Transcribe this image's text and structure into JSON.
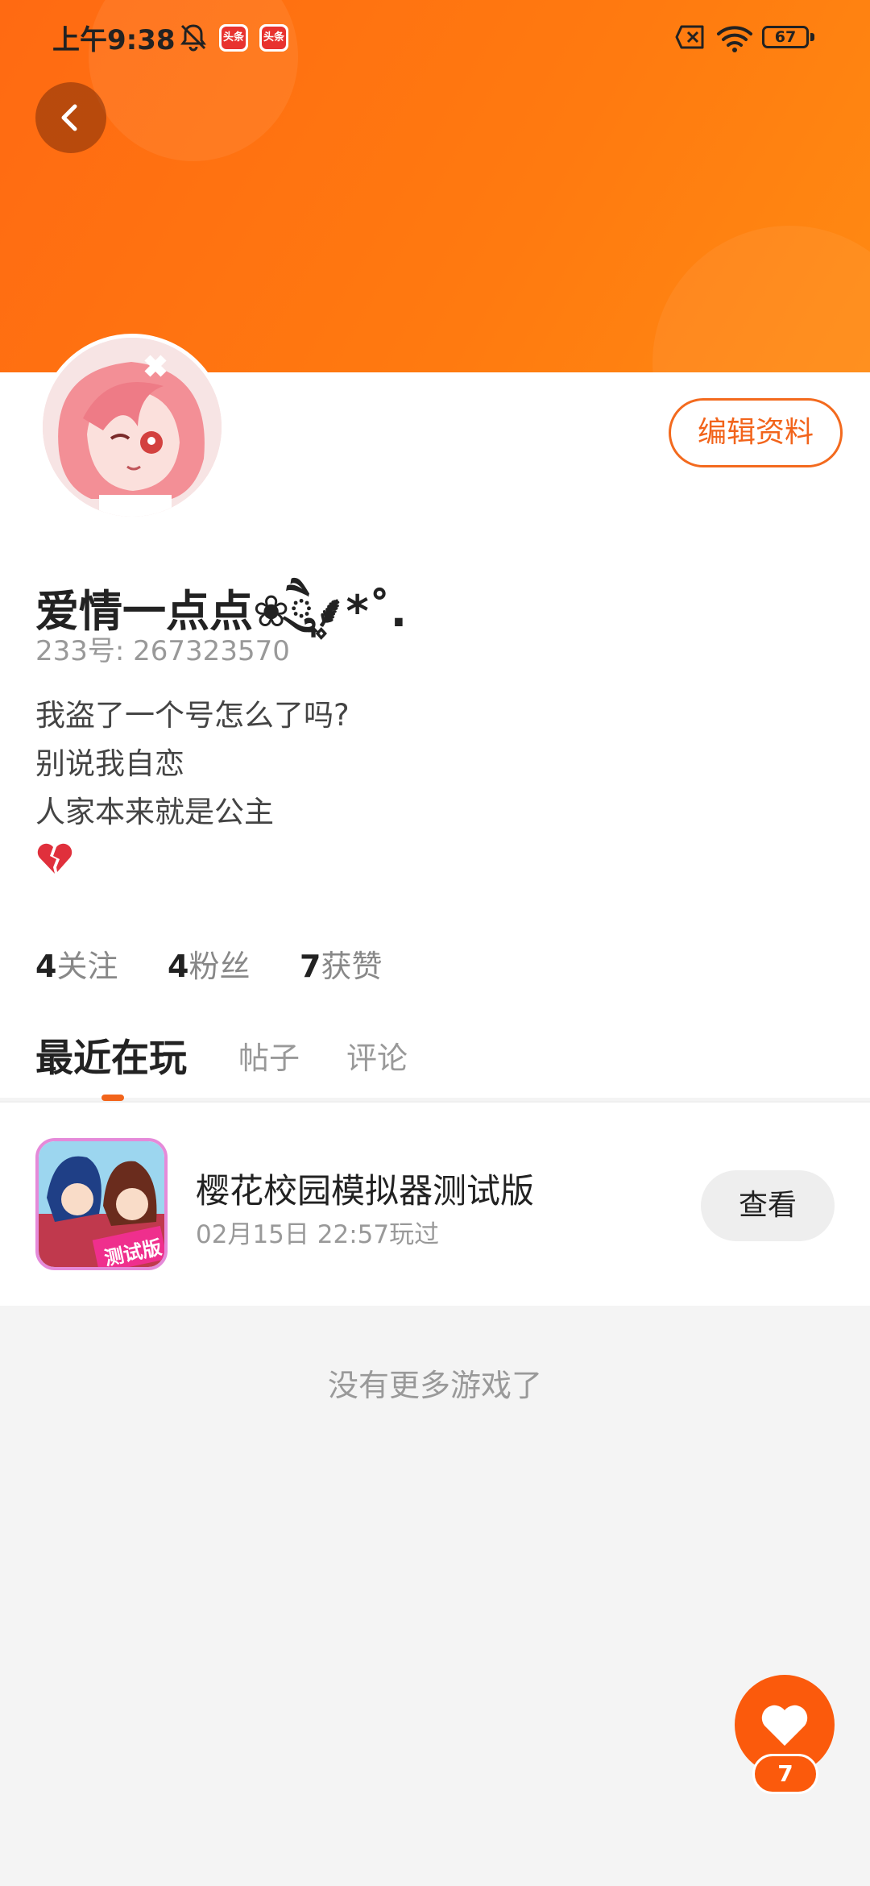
{
  "status_bar": {
    "time": "上午9:38",
    "badge_label": "头条",
    "battery": "67"
  },
  "profile": {
    "edit_label": "编辑资料",
    "nickname": "爱情一点点❀ཻུ۪۪⸙͎*˚.",
    "uid": "233号: 267323570",
    "bio_lines": [
      "我盗了一个号怎么了吗?",
      "别说我自恋",
      "人家本来就是公主"
    ],
    "stats": [
      {
        "count": "4",
        "label": "关注"
      },
      {
        "count": "4",
        "label": "粉丝"
      },
      {
        "count": "7",
        "label": "获赞"
      }
    ]
  },
  "tabs": [
    {
      "label": "最近在玩",
      "active": true
    },
    {
      "label": "帖子",
      "active": false
    },
    {
      "label": "评论",
      "active": false
    }
  ],
  "games": [
    {
      "title": "樱花校园模拟器测试版",
      "meta": "02月15日 22:57玩过",
      "action": "查看",
      "icon_badge": "测试版"
    }
  ],
  "footer_note": "没有更多游戏了",
  "like_fab": {
    "count": "7"
  },
  "colors": {
    "accent": "#f2641b",
    "header": "#ff7412",
    "background": "#f4f4f4"
  },
  "icons": {
    "back": "chevron-left-icon",
    "mute": "bell-off-icon",
    "wifi": "wifi-icon",
    "battery": "battery-icon",
    "like": "heart-icon",
    "bio_emoji": "broken-heart-icon"
  }
}
